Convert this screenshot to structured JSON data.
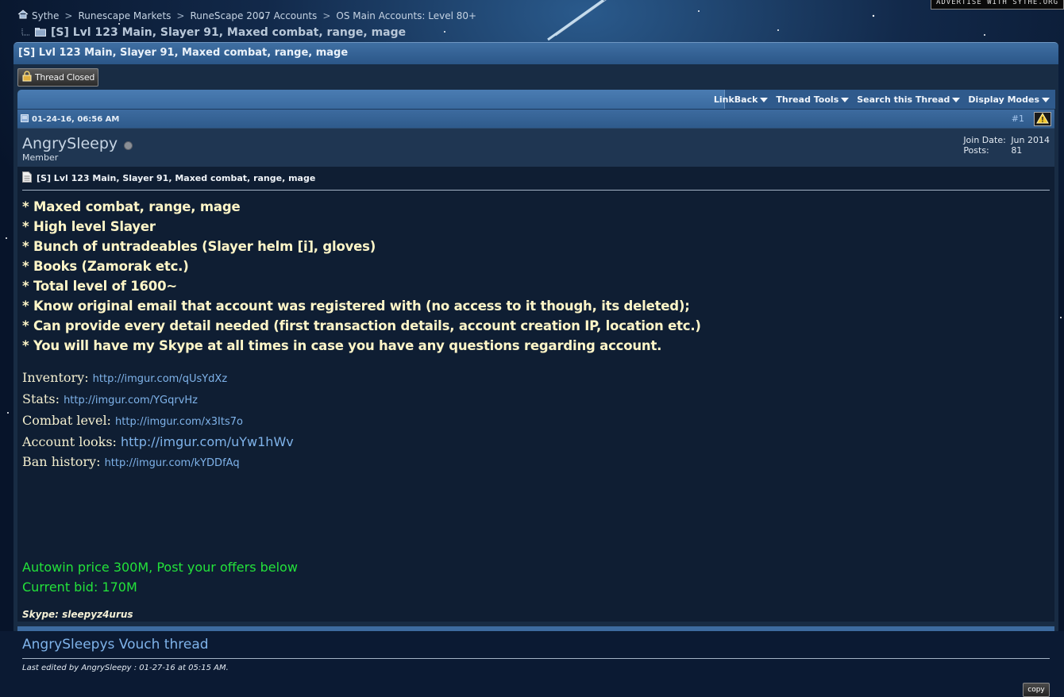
{
  "ad": {
    "text": "ADVERTISE WITH SYTHE.ORG"
  },
  "breadcrumb": {
    "items": [
      "Sythe",
      "Runescape Markets",
      "RuneScape 2007 Accounts",
      "OS Main Accounts: Level 80+"
    ],
    "separator": ">",
    "current": "[S] Lvl 123 Main, Slayer 91, Maxed combat, range, mage"
  },
  "thread": {
    "title": "[S] Lvl 123 Main, Slayer 91, Maxed combat, range, mage",
    "closed_label": "Thread Closed"
  },
  "toolbar": {
    "linkback": "LinkBack",
    "thread_tools": "Thread Tools",
    "search": "Search this Thread",
    "display": "Display Modes"
  },
  "post": {
    "date": "01-24-16, 06:56 AM",
    "number": "#1",
    "username": "AngrySleepy",
    "user_title": "Member",
    "join_label": "Join Date:",
    "join_value": "Jun 2014",
    "posts_label": "Posts:",
    "posts_value": "81",
    "title": "[S] Lvl 123 Main, Slayer 91, Maxed combat, range, mage",
    "bullets": [
      "* Maxed combat, range, mage",
      "* High level Slayer",
      "* Bunch of untradeables (Slayer helm [i], gloves)",
      "* Books (Zamorak etc.)",
      "* Total level of 1600~",
      "* Know original email that account was registered with (no access to it though, its deleted);",
      "* Can provide every detail needed (first transaction details, account creation IP, location etc.)",
      "* You will have my Skype at all times in case you have any questions regarding account."
    ],
    "links": [
      {
        "label": "Inventory:",
        "url": "http://imgur.com/qUsYdXz"
      },
      {
        "label": "Stats:",
        "url": "http://imgur.com/YGqrvHz"
      },
      {
        "label": "Combat level:",
        "url": "http://imgur.com/x3Its7o"
      },
      {
        "label": "Account looks:",
        "url": "http://imgur.com/uYw1hWv"
      },
      {
        "label": "Ban history:",
        "url": "http://imgur.com/kYDDfAq"
      }
    ],
    "price": "Autowin price 300M, Post your offers below",
    "bid": "Current bid: 170M",
    "skype": "Skype: sleepyz4urus",
    "vouch": "AngrySleepys Vouch thread",
    "edited": "Last edited by AngrySleepy : 01-27-16 at 05:15 AM.",
    "copy_label": "copy"
  },
  "colors": {
    "title_bar": "#3f6fa3",
    "post_bg": "#0f1e33",
    "bullet_text": "#fff6c8",
    "link": "#7fb3ea",
    "green_text": "#23e23a"
  }
}
